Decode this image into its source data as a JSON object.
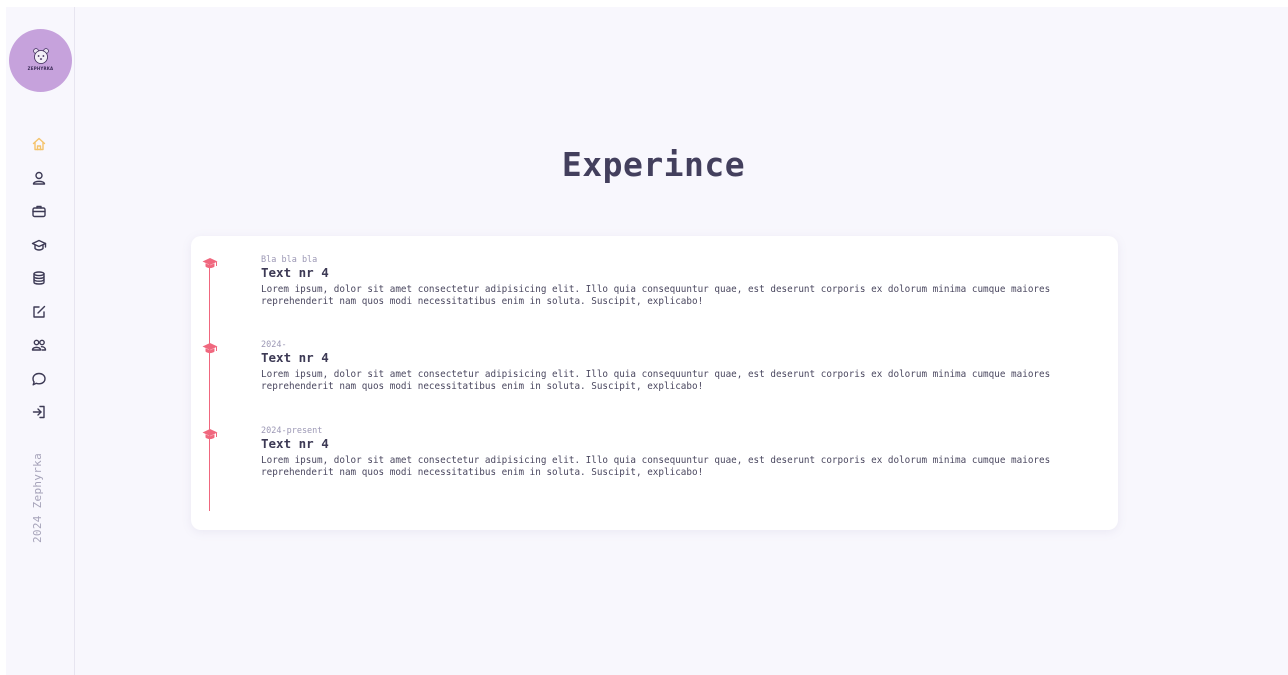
{
  "sidebar": {
    "logo_text": "ZEPHYRKA",
    "nav_items": [
      {
        "icon": "home-icon",
        "active": true
      },
      {
        "icon": "user-icon",
        "active": false
      },
      {
        "icon": "briefcase-icon",
        "active": false
      },
      {
        "icon": "graduation-cap-icon",
        "active": false
      },
      {
        "icon": "database-icon",
        "active": false
      },
      {
        "icon": "edit-icon",
        "active": false
      },
      {
        "icon": "users-icon",
        "active": false
      },
      {
        "icon": "chat-icon",
        "active": false
      },
      {
        "icon": "login-icon",
        "active": false
      }
    ],
    "copyright": "2024 Zephyrka"
  },
  "main": {
    "title": "Experince",
    "timeline": [
      {
        "date": "Bla bla bla",
        "heading": "Text nr 4",
        "body": "Lorem ipsum, dolor sit amet consectetur adipisicing elit. Illo quia consequuntur quae, est deserunt corporis ex dolorum minima cumque maiores reprehenderit nam quos modi necessitatibus enim in soluta. Suscipit, explicabo!"
      },
      {
        "date": "2024-",
        "heading": "Text nr 4",
        "body": "Lorem ipsum, dolor sit amet consectetur adipisicing elit. Illo quia consequuntur quae, est deserunt corporis ex dolorum minima cumque maiores reprehenderit nam quos modi necessitatibus enim in soluta. Suscipit, explicabo!"
      },
      {
        "date": "2024-present",
        "heading": "Text nr 4",
        "body": "Lorem ipsum, dolor sit amet consectetur adipisicing elit. Illo quia consequuntur quae, est deserunt corporis ex dolorum minima cumque maiores reprehenderit nam quos modi necessitatibus enim in soluta. Suscipit, explicabo!"
      }
    ]
  },
  "colors": {
    "accent": "#f4c36b",
    "timeline": "#f0677e",
    "logo_bg": "#c6a2dc",
    "title": "#433f5d"
  }
}
